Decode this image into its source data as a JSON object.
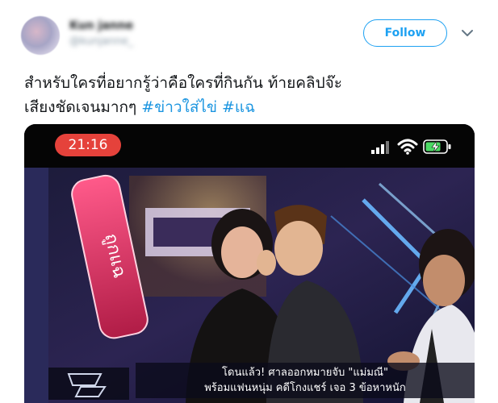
{
  "tweet": {
    "display_name": "Kun janne",
    "handle": "@kunjanne_",
    "follow_label": "Follow",
    "text_main": "สำหรับใครที่อยากรู้ว่าคือใครที่กินกัน ท้ายคลิปจ๊ะ",
    "text_line2": "เสียงชัดเจนมากๆ ",
    "hashtag_1": "#ข่าวใส่ไข่",
    "hashtag_2": "#แฉ"
  },
  "video": {
    "phone_time": "21:16",
    "caption_line1": "โดนแล้ว! ศาลออกหมายจับ \"แม่มณี\"",
    "caption_line2": "พร้อมแฟนหนุ่ม คดีโกงแชร์ เจอ 3 ข้อหาหนัก",
    "set_sign_text": "ถูกแฉ"
  },
  "colors": {
    "accent": "#1da1f2",
    "hashtag": "#1b95e0",
    "time_pill": "#e5423b",
    "battery": "#4cd964"
  },
  "icons": [
    "chevron-down-icon",
    "signal-icon",
    "wifi-icon",
    "battery-charging-icon"
  ]
}
